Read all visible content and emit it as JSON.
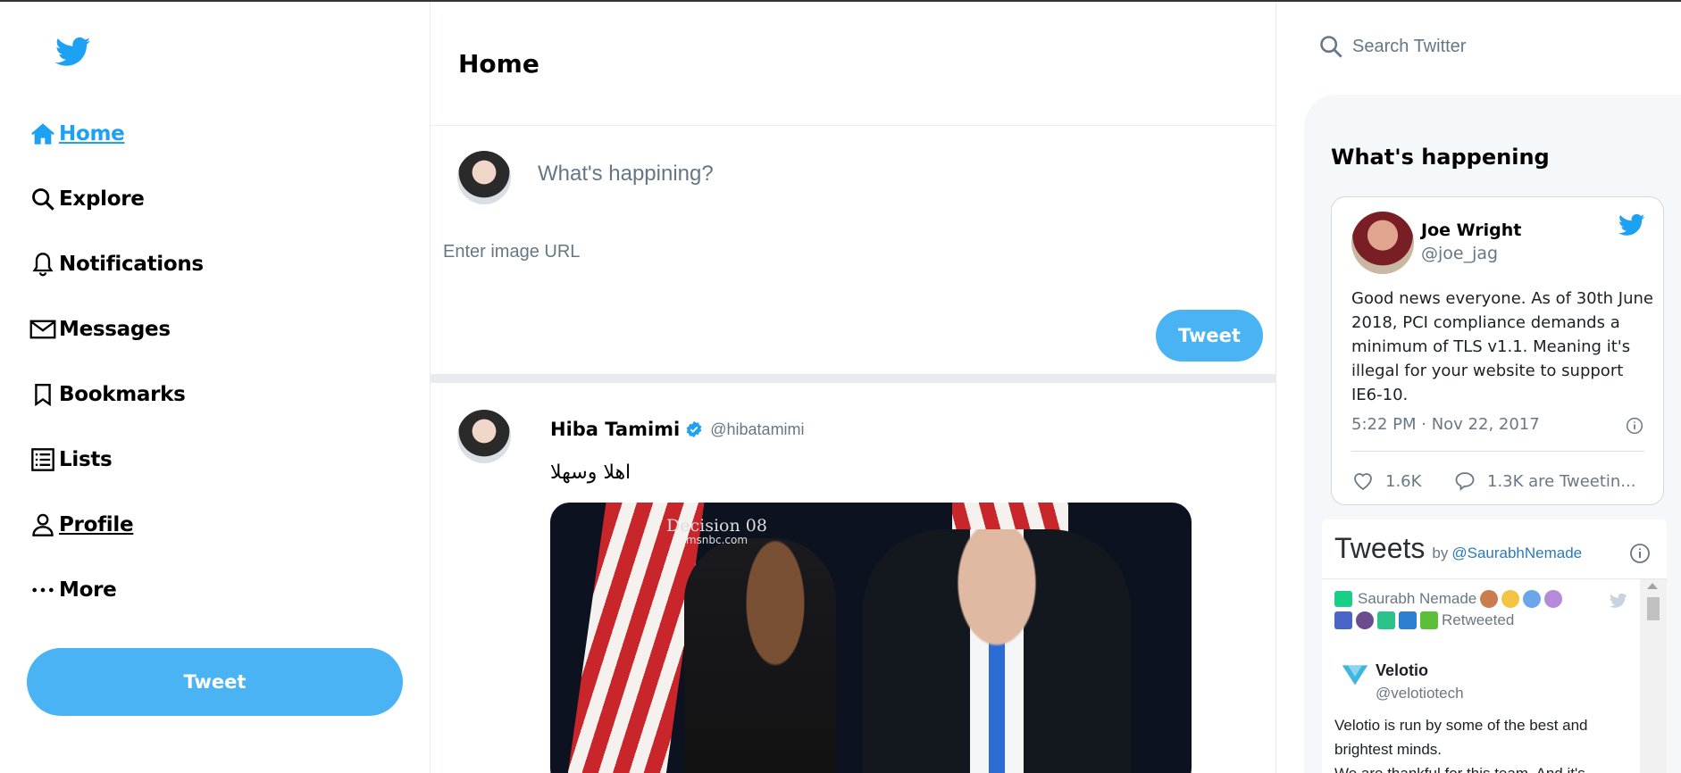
{
  "sidebar": {
    "nav": [
      {
        "label": "Home",
        "icon": "home-icon"
      },
      {
        "label": "Explore",
        "icon": "search-icon"
      },
      {
        "label": "Notifications",
        "icon": "bell-icon"
      },
      {
        "label": "Messages",
        "icon": "mail-icon"
      },
      {
        "label": "Bookmarks",
        "icon": "bookmark-icon"
      },
      {
        "label": "Lists",
        "icon": "list-icon"
      },
      {
        "label": "Profile",
        "icon": "person-icon"
      },
      {
        "label": "More",
        "icon": "more-icon"
      }
    ],
    "tweet_button": "Tweet"
  },
  "center": {
    "title": "Home",
    "compose": {
      "placeholder": "What's happining?",
      "image_placeholder": "Enter image URL",
      "tweet_button": "Tweet"
    },
    "tweet": {
      "name": "Hiba Tamimi",
      "handle": "@hibatamimi",
      "text": "اهلا وسهلا",
      "media_watermark_top": "Decision 08",
      "media_watermark_bottom": "msnbc.com"
    }
  },
  "right": {
    "search_placeholder": "Search Twitter",
    "whats_happening": "What's happening",
    "card": {
      "name": "Joe Wright",
      "handle": "@joe_jag",
      "text": "Good news everyone. As of 30th June 2018, PCI compliance demands a minimum of TLS v1.1. Meaning it's illegal for your website to support IE6-10.",
      "time": "5:22 PM · Nov 22, 2017",
      "likes": "1.6K",
      "replies": "1.3K are Tweetin..."
    },
    "timeline": {
      "title": "Tweets",
      "by": "by",
      "user": "@SaurabhNemade",
      "retweeter": "Saurabh Nemade",
      "retweeted": "Retweeted",
      "author_name": "Velotio",
      "author_handle": "@velotiotech",
      "text_line1": "Velotio is run by some of the best and brightest minds.",
      "text_line2": "We are thankful for this team. And it's"
    }
  },
  "colors": {
    "brand_blue": "#1da1f2",
    "button_blue": "#4ab3f4",
    "muted": "#657786"
  }
}
